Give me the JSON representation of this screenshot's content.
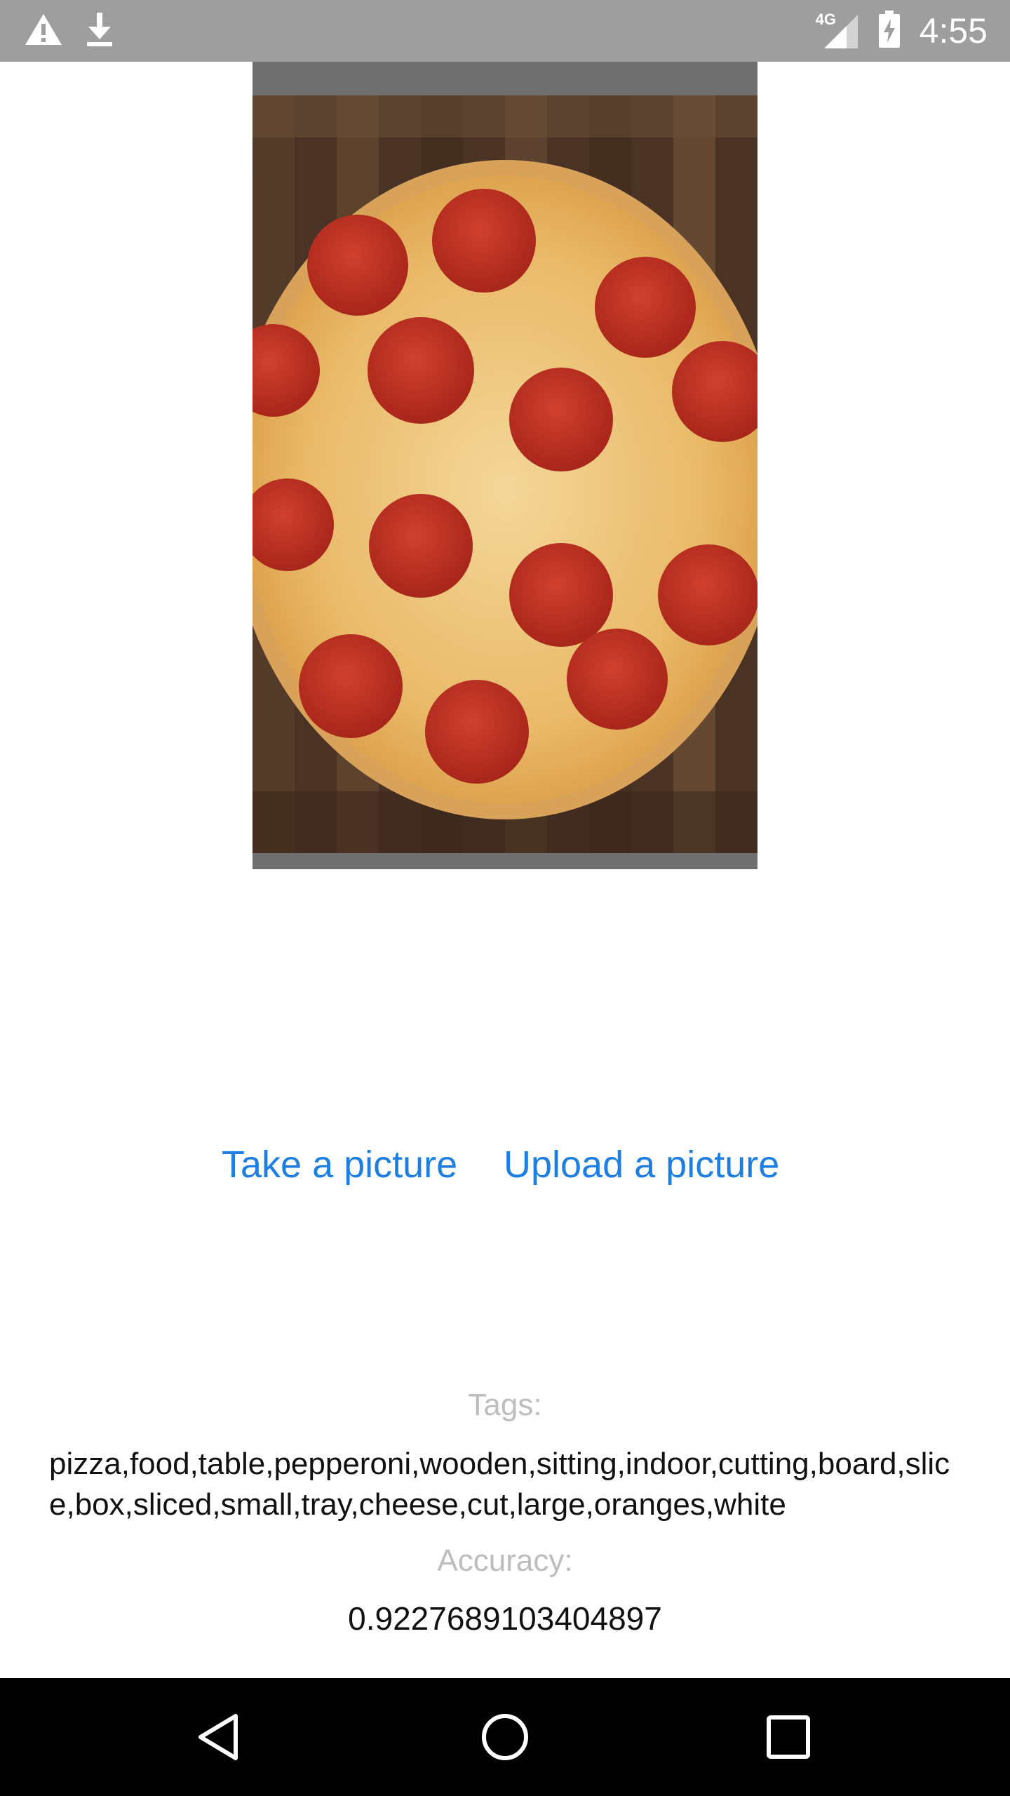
{
  "status_bar": {
    "time": "4:55",
    "network": "4G",
    "icons": [
      "warning-icon",
      "download-icon",
      "signal-icon",
      "battery-charging-icon"
    ]
  },
  "photo": {
    "subject": "pepperoni-pizza-photo"
  },
  "actions": {
    "take_label": "Take a picture",
    "upload_label": "Upload a picture",
    "color": "#1e7fe0"
  },
  "results": {
    "tags_label": "Tags:",
    "tags_value": "pizza,food,table,pepperoni,wooden,sitting,indoor,cutting,board,slice,box,sliced,small,tray,cheese,cut,large,oranges,white",
    "accuracy_label": "Accuracy:",
    "accuracy_value": "0.9227689103404897"
  },
  "nav_bar": {
    "icons": [
      "back-icon",
      "home-icon",
      "recents-icon"
    ]
  }
}
